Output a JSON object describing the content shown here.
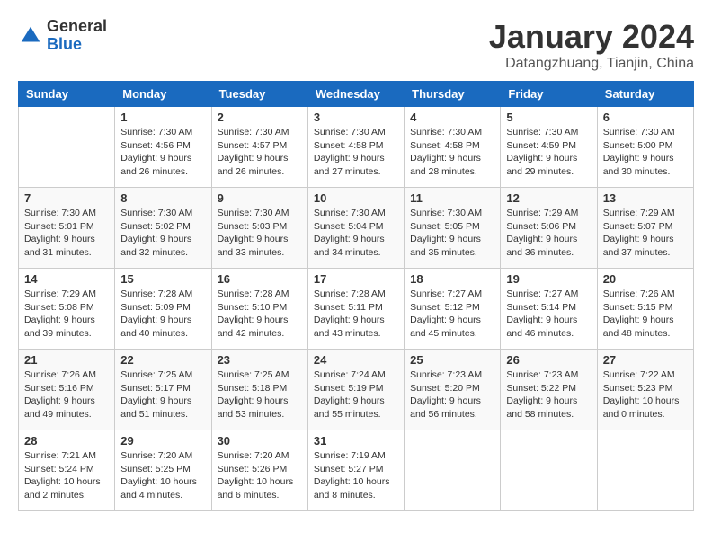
{
  "header": {
    "logo_general": "General",
    "logo_blue": "Blue",
    "month_title": "January 2024",
    "location": "Datangzhuang, Tianjin, China"
  },
  "weekdays": [
    "Sunday",
    "Monday",
    "Tuesday",
    "Wednesday",
    "Thursday",
    "Friday",
    "Saturday"
  ],
  "weeks": [
    [
      {
        "day": "",
        "sunrise": "",
        "sunset": "",
        "daylight": ""
      },
      {
        "day": "1",
        "sunrise": "Sunrise: 7:30 AM",
        "sunset": "Sunset: 4:56 PM",
        "daylight": "Daylight: 9 hours and 26 minutes."
      },
      {
        "day": "2",
        "sunrise": "Sunrise: 7:30 AM",
        "sunset": "Sunset: 4:57 PM",
        "daylight": "Daylight: 9 hours and 26 minutes."
      },
      {
        "day": "3",
        "sunrise": "Sunrise: 7:30 AM",
        "sunset": "Sunset: 4:58 PM",
        "daylight": "Daylight: 9 hours and 27 minutes."
      },
      {
        "day": "4",
        "sunrise": "Sunrise: 7:30 AM",
        "sunset": "Sunset: 4:58 PM",
        "daylight": "Daylight: 9 hours and 28 minutes."
      },
      {
        "day": "5",
        "sunrise": "Sunrise: 7:30 AM",
        "sunset": "Sunset: 4:59 PM",
        "daylight": "Daylight: 9 hours and 29 minutes."
      },
      {
        "day": "6",
        "sunrise": "Sunrise: 7:30 AM",
        "sunset": "Sunset: 5:00 PM",
        "daylight": "Daylight: 9 hours and 30 minutes."
      }
    ],
    [
      {
        "day": "7",
        "sunrise": "Sunrise: 7:30 AM",
        "sunset": "Sunset: 5:01 PM",
        "daylight": "Daylight: 9 hours and 31 minutes."
      },
      {
        "day": "8",
        "sunrise": "Sunrise: 7:30 AM",
        "sunset": "Sunset: 5:02 PM",
        "daylight": "Daylight: 9 hours and 32 minutes."
      },
      {
        "day": "9",
        "sunrise": "Sunrise: 7:30 AM",
        "sunset": "Sunset: 5:03 PM",
        "daylight": "Daylight: 9 hours and 33 minutes."
      },
      {
        "day": "10",
        "sunrise": "Sunrise: 7:30 AM",
        "sunset": "Sunset: 5:04 PM",
        "daylight": "Daylight: 9 hours and 34 minutes."
      },
      {
        "day": "11",
        "sunrise": "Sunrise: 7:30 AM",
        "sunset": "Sunset: 5:05 PM",
        "daylight": "Daylight: 9 hours and 35 minutes."
      },
      {
        "day": "12",
        "sunrise": "Sunrise: 7:29 AM",
        "sunset": "Sunset: 5:06 PM",
        "daylight": "Daylight: 9 hours and 36 minutes."
      },
      {
        "day": "13",
        "sunrise": "Sunrise: 7:29 AM",
        "sunset": "Sunset: 5:07 PM",
        "daylight": "Daylight: 9 hours and 37 minutes."
      }
    ],
    [
      {
        "day": "14",
        "sunrise": "Sunrise: 7:29 AM",
        "sunset": "Sunset: 5:08 PM",
        "daylight": "Daylight: 9 hours and 39 minutes."
      },
      {
        "day": "15",
        "sunrise": "Sunrise: 7:28 AM",
        "sunset": "Sunset: 5:09 PM",
        "daylight": "Daylight: 9 hours and 40 minutes."
      },
      {
        "day": "16",
        "sunrise": "Sunrise: 7:28 AM",
        "sunset": "Sunset: 5:10 PM",
        "daylight": "Daylight: 9 hours and 42 minutes."
      },
      {
        "day": "17",
        "sunrise": "Sunrise: 7:28 AM",
        "sunset": "Sunset: 5:11 PM",
        "daylight": "Daylight: 9 hours and 43 minutes."
      },
      {
        "day": "18",
        "sunrise": "Sunrise: 7:27 AM",
        "sunset": "Sunset: 5:12 PM",
        "daylight": "Daylight: 9 hours and 45 minutes."
      },
      {
        "day": "19",
        "sunrise": "Sunrise: 7:27 AM",
        "sunset": "Sunset: 5:14 PM",
        "daylight": "Daylight: 9 hours and 46 minutes."
      },
      {
        "day": "20",
        "sunrise": "Sunrise: 7:26 AM",
        "sunset": "Sunset: 5:15 PM",
        "daylight": "Daylight: 9 hours and 48 minutes."
      }
    ],
    [
      {
        "day": "21",
        "sunrise": "Sunrise: 7:26 AM",
        "sunset": "Sunset: 5:16 PM",
        "daylight": "Daylight: 9 hours and 49 minutes."
      },
      {
        "day": "22",
        "sunrise": "Sunrise: 7:25 AM",
        "sunset": "Sunset: 5:17 PM",
        "daylight": "Daylight: 9 hours and 51 minutes."
      },
      {
        "day": "23",
        "sunrise": "Sunrise: 7:25 AM",
        "sunset": "Sunset: 5:18 PM",
        "daylight": "Daylight: 9 hours and 53 minutes."
      },
      {
        "day": "24",
        "sunrise": "Sunrise: 7:24 AM",
        "sunset": "Sunset: 5:19 PM",
        "daylight": "Daylight: 9 hours and 55 minutes."
      },
      {
        "day": "25",
        "sunrise": "Sunrise: 7:23 AM",
        "sunset": "Sunset: 5:20 PM",
        "daylight": "Daylight: 9 hours and 56 minutes."
      },
      {
        "day": "26",
        "sunrise": "Sunrise: 7:23 AM",
        "sunset": "Sunset: 5:22 PM",
        "daylight": "Daylight: 9 hours and 58 minutes."
      },
      {
        "day": "27",
        "sunrise": "Sunrise: 7:22 AM",
        "sunset": "Sunset: 5:23 PM",
        "daylight": "Daylight: 10 hours and 0 minutes."
      }
    ],
    [
      {
        "day": "28",
        "sunrise": "Sunrise: 7:21 AM",
        "sunset": "Sunset: 5:24 PM",
        "daylight": "Daylight: 10 hours and 2 minutes."
      },
      {
        "day": "29",
        "sunrise": "Sunrise: 7:20 AM",
        "sunset": "Sunset: 5:25 PM",
        "daylight": "Daylight: 10 hours and 4 minutes."
      },
      {
        "day": "30",
        "sunrise": "Sunrise: 7:20 AM",
        "sunset": "Sunset: 5:26 PM",
        "daylight": "Daylight: 10 hours and 6 minutes."
      },
      {
        "day": "31",
        "sunrise": "Sunrise: 7:19 AM",
        "sunset": "Sunset: 5:27 PM",
        "daylight": "Daylight: 10 hours and 8 minutes."
      },
      {
        "day": "",
        "sunrise": "",
        "sunset": "",
        "daylight": ""
      },
      {
        "day": "",
        "sunrise": "",
        "sunset": "",
        "daylight": ""
      },
      {
        "day": "",
        "sunrise": "",
        "sunset": "",
        "daylight": ""
      }
    ]
  ]
}
